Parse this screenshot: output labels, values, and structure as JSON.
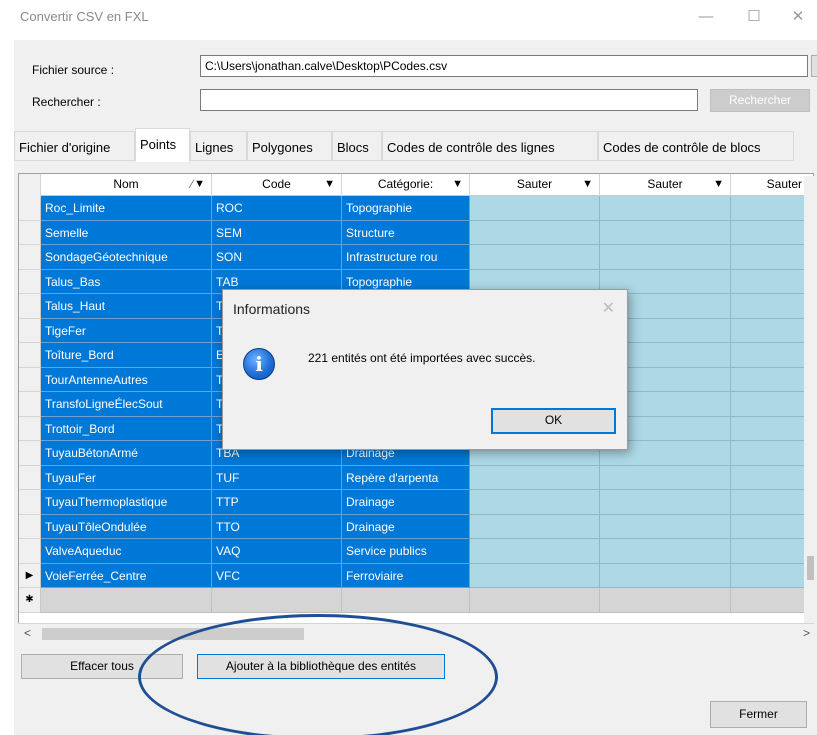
{
  "window": {
    "title": "Convertir CSV en FXL",
    "minimize": "—",
    "maximize": "☐",
    "close": "✕"
  },
  "form": {
    "source_label": "Fichier source :",
    "source_value": "C:\\Users\\jonathan.calve\\Desktop\\PCodes.csv",
    "browse_label": "...",
    "search_label": "Rechercher :",
    "search_value": "",
    "search_button": "Rechercher"
  },
  "tabs": [
    {
      "label": "Fichier d'origine"
    },
    {
      "label": "Points"
    },
    {
      "label": "Lignes"
    },
    {
      "label": "Polygones"
    },
    {
      "label": "Blocs"
    },
    {
      "label": "Codes de contrôle des lignes"
    },
    {
      "label": "Codes de contrôle de blocs"
    }
  ],
  "grid": {
    "columns": [
      {
        "label": "Nom",
        "sort": "⁄"
      },
      {
        "label": "Code"
      },
      {
        "label": "Catégorie:"
      },
      {
        "label": "Sauter"
      },
      {
        "label": "Sauter"
      },
      {
        "label": "Sauter"
      }
    ],
    "filter_icon": "▼",
    "rows": [
      {
        "nom": "Roc_Limite",
        "code": "ROC",
        "cat": "Topographie"
      },
      {
        "nom": "Semelle",
        "code": "SEM",
        "cat": "Structure"
      },
      {
        "nom": "SondageGéotechnique",
        "code": "SON",
        "cat": "Infrastructure rou"
      },
      {
        "nom": "Talus_Bas",
        "code": "TAB",
        "cat": "Topographie"
      },
      {
        "nom": "Talus_Haut",
        "code": "T",
        "cat": ""
      },
      {
        "nom": "TigeFer",
        "code": "T",
        "cat": ""
      },
      {
        "nom": "Toîture_Bord",
        "code": "E",
        "cat": ""
      },
      {
        "nom": "TourAntenneAutres",
        "code": "T",
        "cat": ""
      },
      {
        "nom": "TransfoLigneÉlecSout",
        "code": "T",
        "cat": ""
      },
      {
        "nom": "Trottoir_Bord",
        "code": "T",
        "cat": ""
      },
      {
        "nom": "TuyauBétonArmé",
        "code": "TBA",
        "cat": "Drainage"
      },
      {
        "nom": "TuyauFer",
        "code": "TUF",
        "cat": "Repère d'arpenta"
      },
      {
        "nom": "TuyauThermoplastique",
        "code": "TTP",
        "cat": "Drainage"
      },
      {
        "nom": "TuyauTôleOndulée",
        "code": "TTO",
        "cat": "Drainage"
      },
      {
        "nom": "ValveAqueduc",
        "code": "VAQ",
        "cat": "Service publics"
      },
      {
        "nom": "VoieFerrée_Centre",
        "code": "VFC",
        "cat": "Ferroviaire"
      }
    ],
    "current_row_marker": "▶",
    "new_row_marker": "✱"
  },
  "scroll": {
    "left_arrow": "<",
    "right_arrow": ">"
  },
  "buttons": {
    "clear_all": "Effacer tous",
    "add_library": "Ajouter à la bibliothèque des entités",
    "close": "Fermer"
  },
  "dialog": {
    "title": "Informations",
    "close": "✕",
    "icon": "i",
    "message": "221 entités ont été importées avec succès.",
    "ok": "OK"
  },
  "colors": {
    "selection": "#0078d7",
    "skip_column": "#add8e6",
    "annotation_ellipse": "#1f4e94"
  }
}
